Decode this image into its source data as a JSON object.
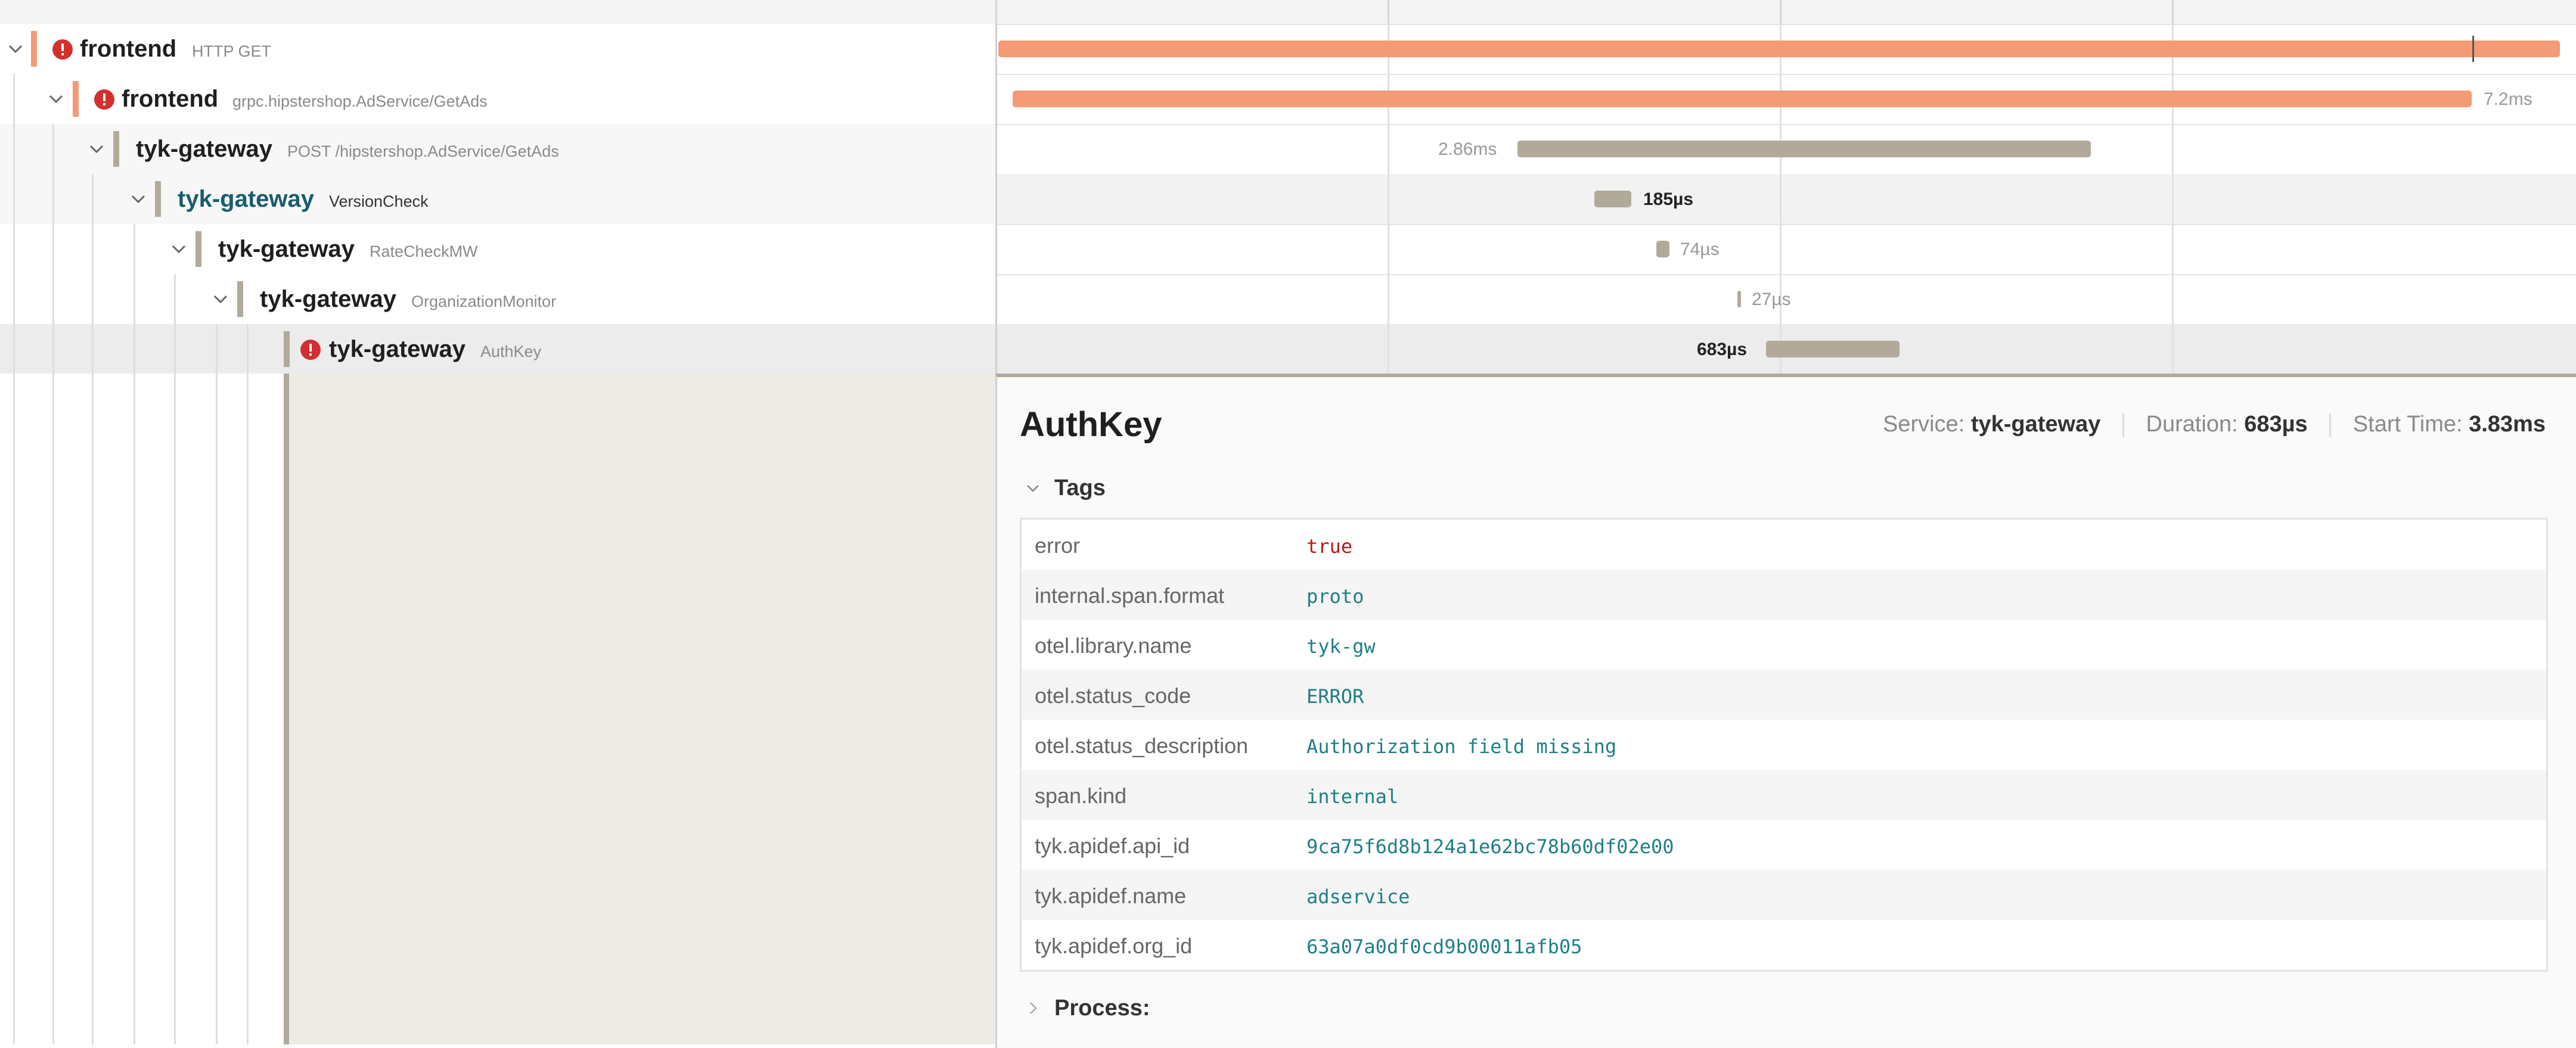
{
  "colors": {
    "frontend_accent": "#f59a76",
    "gateway_accent": "#b1aa9a",
    "error_icon": "#d32f2f",
    "tag_value": "#1e7f85",
    "tag_error_value": "#b31b1b"
  },
  "spans": [
    {
      "service": "frontend",
      "operation": "HTTP GET",
      "error": true,
      "expanded": true,
      "duration_label": ""
    },
    {
      "service": "frontend",
      "operation": "grpc.hipstershop.AdService/GetAds",
      "error": true,
      "expanded": true,
      "duration_label": "7.2ms"
    },
    {
      "service": "tyk-gateway",
      "operation": "POST /hipstershop.AdService/GetAds",
      "error": false,
      "expanded": true,
      "duration_label": "2.86ms"
    },
    {
      "service": "tyk-gateway",
      "operation": "VersionCheck",
      "error": false,
      "expanded": true,
      "duration_label": "185µs"
    },
    {
      "service": "tyk-gateway",
      "operation": "RateCheckMW",
      "error": false,
      "expanded": true,
      "duration_label": "74µs"
    },
    {
      "service": "tyk-gateway",
      "operation": "OrganizationMonitor",
      "error": false,
      "expanded": true,
      "duration_label": "27µs"
    },
    {
      "service": "tyk-gateway",
      "operation": "AuthKey",
      "error": true,
      "expanded": false,
      "duration_label": "683µs"
    }
  ],
  "detail": {
    "title": "AuthKey",
    "service_label": "Service:",
    "service_value": "tyk-gateway",
    "duration_label": "Duration:",
    "duration_value": "683µs",
    "start_label": "Start Time:",
    "start_value": "3.83ms",
    "tags_label": "Tags",
    "process_label": "Process:",
    "tags": [
      {
        "key": "error",
        "value": "true"
      },
      {
        "key": "internal.span.format",
        "value": "proto"
      },
      {
        "key": "otel.library.name",
        "value": "tyk-gw"
      },
      {
        "key": "otel.status_code",
        "value": "ERROR"
      },
      {
        "key": "otel.status_description",
        "value": "Authorization field missing"
      },
      {
        "key": "span.kind",
        "value": "internal"
      },
      {
        "key": "tyk.apidef.api_id",
        "value": "9ca75f6d8b124a1e62bc78b60df02e00"
      },
      {
        "key": "tyk.apidef.name",
        "value": "adservice"
      },
      {
        "key": "tyk.apidef.org_id",
        "value": "63a07a0df0cd9b00011afb05"
      }
    ]
  }
}
